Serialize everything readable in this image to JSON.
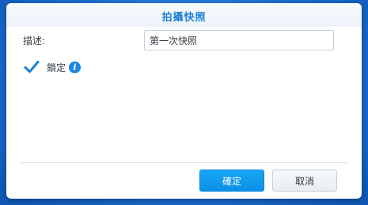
{
  "dialog": {
    "title": "拍攝快照",
    "description_label": "描述:",
    "description_value": "第一次快照",
    "lock_label": "鎖定",
    "lock_checked": true,
    "info_icon_glyph": "i",
    "ok_label": "確定",
    "cancel_label": "取消"
  },
  "icons": {
    "checkbox": "checkmark-icon",
    "info": "info-icon"
  },
  "colors": {
    "accent": "#1a7fd8",
    "primary_button": "#0c8fe6",
    "background": "#1565c8"
  }
}
